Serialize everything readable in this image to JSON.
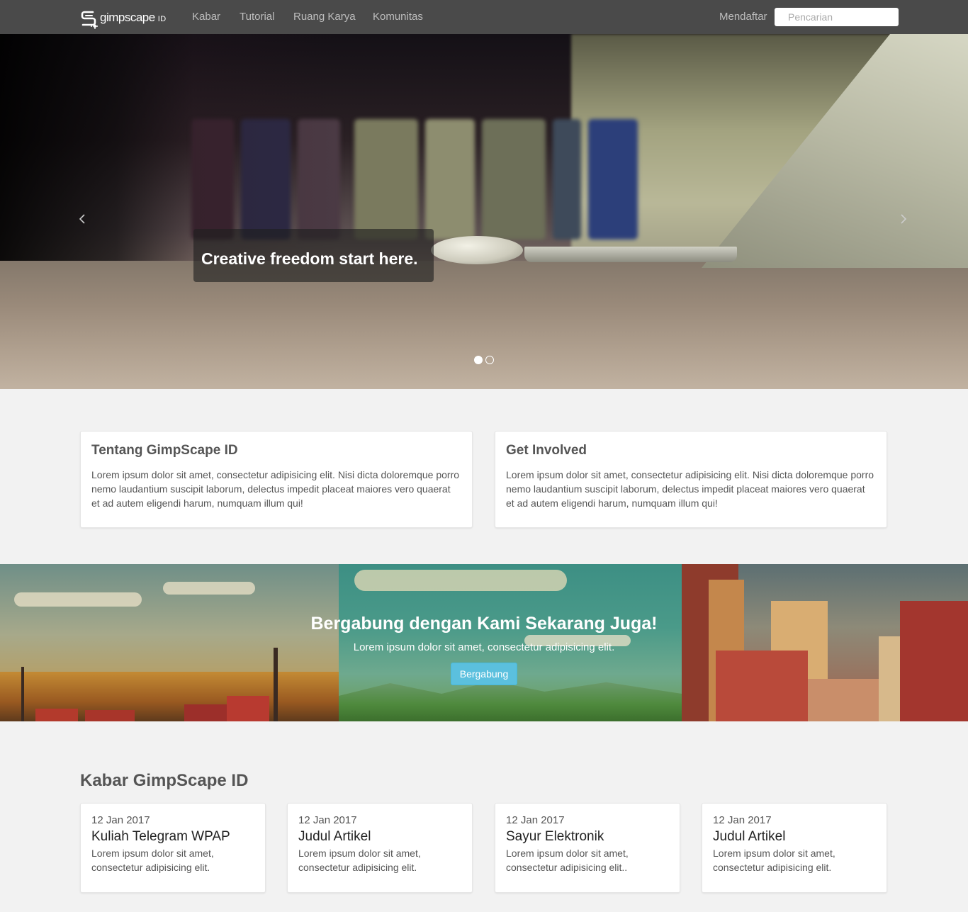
{
  "navbar": {
    "brand": {
      "name": "gimpscape",
      "suffix": "ID"
    },
    "links": [
      "Kabar",
      "Tutorial",
      "Ruang Karya",
      "Komunitas"
    ],
    "signup_label": "Mendaftar",
    "search": {
      "placeholder": "Pencarian",
      "value": ""
    }
  },
  "hero": {
    "caption": "Creative freedom start here.",
    "slide_count": 2,
    "active_slide": 1
  },
  "info_cards": [
    {
      "title": "Tentang GimpScape ID",
      "body": "Lorem ipsum dolor sit amet, consectetur adipisicing elit. Nisi dicta doloremque porro nemo laudantium suscipit laborum, delectus impedit placeat maiores vero quaerat et ad autem eligendi harum, numquam illum qui!"
    },
    {
      "title": "Get Involved",
      "body": "Lorem ipsum dolor sit amet, consectetur adipisicing elit. Nisi dicta doloremque porro nemo laudantium suscipit laborum, delectus impedit placeat maiores vero quaerat et ad autem eligendi harum, numquam illum qui!"
    }
  ],
  "join": {
    "title": "Bergabung dengan Kami Sekarang Juga!",
    "subtitle": "Lorem ipsum dolor sit amet, consectetur adipisicing elit.",
    "button_label": "Bergabung"
  },
  "news": {
    "heading": "Kabar GimpScape ID",
    "items": [
      {
        "date": "12 Jan 2017",
        "title": "Kuliah Telegram WPAP",
        "excerpt": "Lorem ipsum dolor sit amet, consectetur adipisicing elit."
      },
      {
        "date": "12 Jan 2017",
        "title": "Judul Artikel",
        "excerpt": "Lorem ipsum dolor sit amet, consectetur adipisicing elit."
      },
      {
        "date": "12 Jan 2017",
        "title": "Sayur Elektronik",
        "excerpt": "Lorem ipsum dolor sit amet, consectetur adipisicing elit.."
      },
      {
        "date": "12 Jan 2017",
        "title": "Judul Artikel",
        "excerpt": "Lorem ipsum dolor sit amet, consectetur adipisicing elit."
      }
    ]
  },
  "colors": {
    "navbar_bg": "#4a4a4a",
    "page_bg": "#f2f2f2",
    "button_info": "#5bc0de"
  },
  "icons": [
    "gimpscape-logo-icon",
    "chevron-left-icon",
    "chevron-right-icon"
  ]
}
